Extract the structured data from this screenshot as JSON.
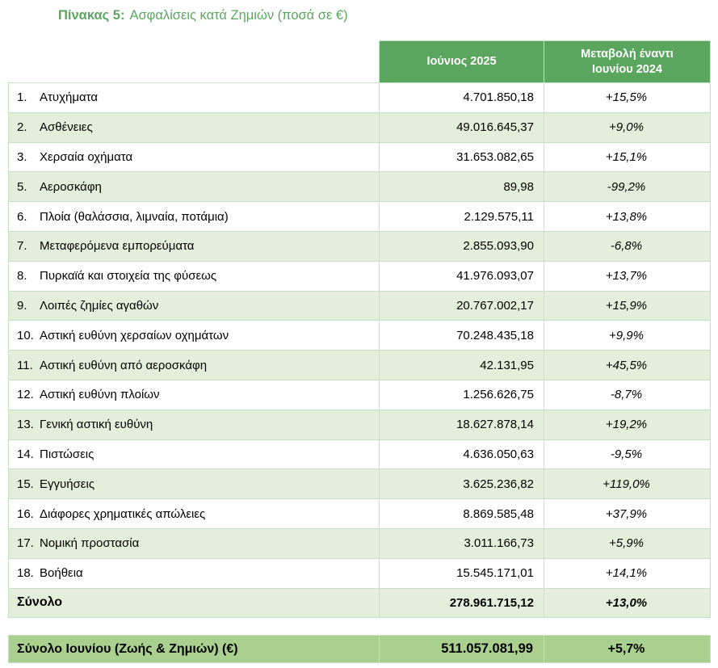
{
  "title": {
    "label": "Πίνακας 5:",
    "text": "Ασφαλίσεις κατά Ζημιών  (ποσά σε €)"
  },
  "table": {
    "headers": [
      "",
      "Ιούνιος 2025",
      "Μεταβολή έναντι Ιουνίου 2024"
    ],
    "rows": [
      {
        "idx": "1.",
        "name": "Ατυχήματα",
        "value": "4.701.850,18",
        "change": "+15,5%"
      },
      {
        "idx": "2.",
        "name": "Ασθένειες",
        "value": "49.016.645,37",
        "change": "+9,0%"
      },
      {
        "idx": "3.",
        "name": "Χερσαία οχήματα",
        "value": "31.653.082,65",
        "change": "+15,1%"
      },
      {
        "idx": "5.",
        "name": "Αεροσκάφη",
        "value": "89,98",
        "change": "-99,2%"
      },
      {
        "idx": "6.",
        "name": "Πλοία (θαλάσσια, λιμναία, ποτάμια)",
        "value": "2.129.575,11",
        "change": "+13,8%"
      },
      {
        "idx": "7.",
        "name": "Μεταφερόμενα εμπορεύματα",
        "value": "2.855.093,90",
        "change": "-6,8%"
      },
      {
        "idx": "8.",
        "name": "Πυρκαϊά και στοιχεία της φύσεως",
        "value": "41.976.093,07",
        "change": "+13,7%"
      },
      {
        "idx": "9.",
        "name": "Λοιπές ζημίες αγαθών",
        "value": "20.767.002,17",
        "change": "+15,9%"
      },
      {
        "idx": "10.",
        "name": "Αστική ευθύνη χερσαίων οχημάτων",
        "value": "70.248.435,18",
        "change": "+9,9%"
      },
      {
        "idx": "11.",
        "name": "Αστική ευθύνη από αεροσκάφη",
        "value": "42.131,95",
        "change": "+45,5%"
      },
      {
        "idx": "12.",
        "name": "Αστική ευθύνη πλοίων",
        "value": "1.256.626,75",
        "change": "-8,7%"
      },
      {
        "idx": "13.",
        "name": "Γενική αστική ευθύνη",
        "value": "18.627.878,14",
        "change": "+19,2%"
      },
      {
        "idx": "14.",
        "name": "Πιστώσεις",
        "value": "4.636.050,63",
        "change": "-9,5%"
      },
      {
        "idx": "15.",
        "name": "Εγγυήσεις",
        "value": "3.625.236,82",
        "change": "+119,0%"
      },
      {
        "idx": "16.",
        "name": "Διάφορες χρηματικές απώλειες",
        "value": "8.869.585,48",
        "change": "+37,9%"
      },
      {
        "idx": "17.",
        "name": "Νομική προστασία",
        "value": "3.011.166,73",
        "change": "+5,9%"
      },
      {
        "idx": "18.",
        "name": "Βοήθεια",
        "value": "15.545.171,01",
        "change": "+14,1%"
      }
    ],
    "total": {
      "name": "Σύνολο",
      "value": "278.961.715,12",
      "change": "+13,0%"
    }
  },
  "grand_total": {
    "name": "Σύνολο Ιουνίου (Ζωής & Ζημιών) (€)",
    "value": "511.057.081,99",
    "change": "+5,7%"
  }
}
